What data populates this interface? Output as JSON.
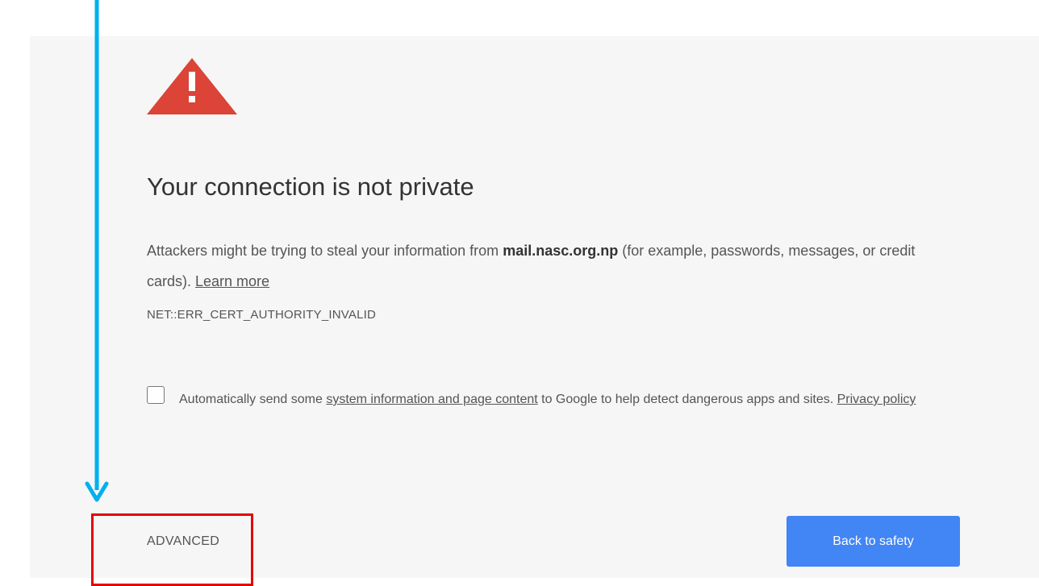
{
  "interstitial": {
    "icon": "warning-triangle-icon",
    "title": "Your connection is not private",
    "desc_prefix": "Attackers might be trying to steal your information from ",
    "domain": "mail.nasc.org.np",
    "desc_suffix": " (for example, passwords, messages, or credit cards). ",
    "learn_more": "Learn more",
    "error_code": "NET::ERR_CERT_AUTHORITY_INVALID",
    "optin": {
      "checked": false,
      "prefix": "Automatically send some ",
      "link": "system information and page content",
      "middle": " to Google to help detect dangerous apps and sites. ",
      "privacy_link": "Privacy policy"
    },
    "advanced_label": "ADVANCED",
    "back_to_safety_label": "Back to safety"
  },
  "annotation": {
    "arrow_color": "#00b0f0",
    "highlight_color": "#e60000"
  },
  "colors": {
    "background": "#f6f6f6",
    "warning_red": "#db4437",
    "button_blue": "#4285f4"
  }
}
